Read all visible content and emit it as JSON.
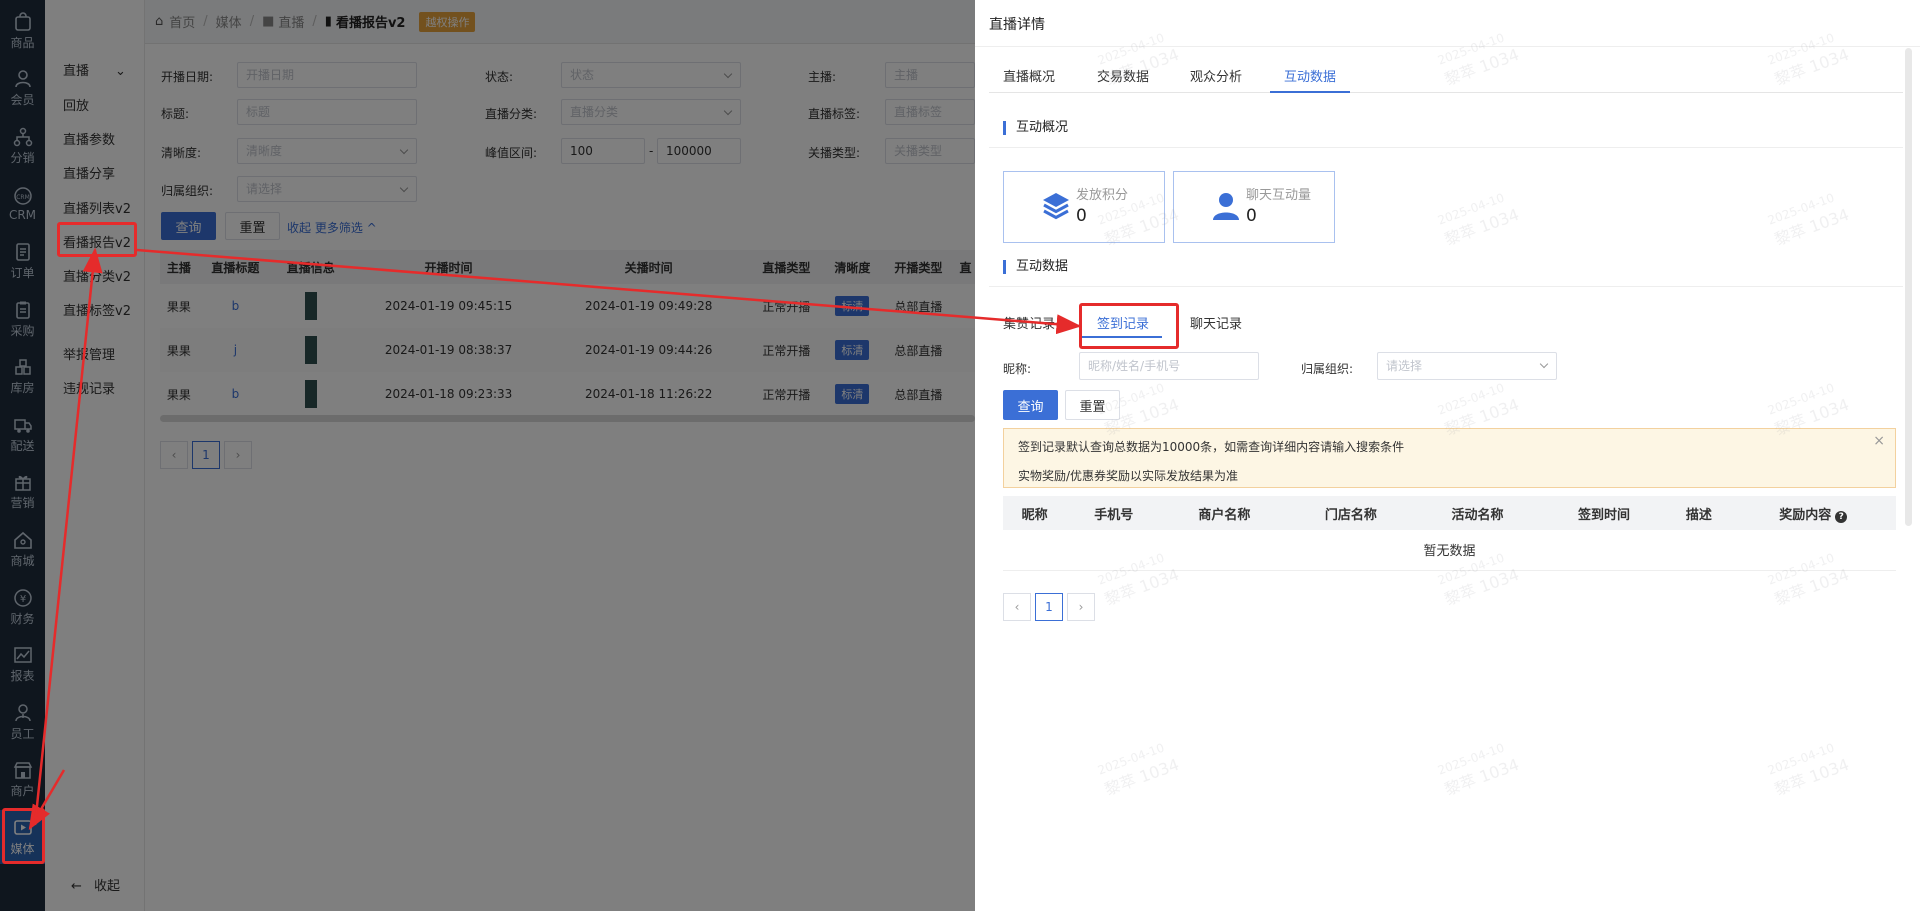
{
  "rail": {
    "items": [
      {
        "label": "商品",
        "icon": "bag-icon"
      },
      {
        "label": "会员",
        "icon": "user-icon"
      },
      {
        "label": "分销",
        "icon": "network-icon"
      },
      {
        "label": "CRM",
        "icon": "crm-icon"
      },
      {
        "label": "订单",
        "icon": "order-icon"
      },
      {
        "label": "采购",
        "icon": "clipboard-icon"
      },
      {
        "label": "库房",
        "icon": "warehouse-icon"
      },
      {
        "label": "配送",
        "icon": "truck-icon"
      },
      {
        "label": "营销",
        "icon": "gift-icon"
      },
      {
        "label": "商城",
        "icon": "home-icon"
      },
      {
        "label": "财务",
        "icon": "yen-icon"
      },
      {
        "label": "报表",
        "icon": "chart-icon"
      },
      {
        "label": "员工",
        "icon": "staff-icon"
      },
      {
        "label": "商户",
        "icon": "shop-icon"
      },
      {
        "label": "媒体",
        "icon": "media-icon"
      }
    ],
    "active_label": "媒体"
  },
  "submenu": {
    "group": "直播",
    "items": [
      "回放",
      "直播参数",
      "直播分享",
      "直播列表v2",
      "看播报告v2",
      "直播分类v2",
      "直播标签v2"
    ],
    "extra": [
      "举报管理",
      "违规记录"
    ],
    "collapse": "收起"
  },
  "breadcrumb": {
    "home": "首页",
    "media": "媒体",
    "live": "直播",
    "current": "看播报告v2",
    "tag": "越权操作"
  },
  "filters": {
    "start_date": {
      "label": "开播日期:",
      "placeholder": "开播日期"
    },
    "status": {
      "label": "状态:",
      "placeholder": "状态"
    },
    "anchor": {
      "label": "主播:",
      "placeholder": "主播"
    },
    "title": {
      "label": "标题:",
      "placeholder": "标题"
    },
    "category": {
      "label": "直播分类:",
      "placeholder": "直播分类"
    },
    "live_tag": {
      "label": "直播标签:",
      "placeholder": "直播标签"
    },
    "clarity": {
      "label": "清晰度:",
      "placeholder": "清晰度"
    },
    "peak": {
      "label": "峰值区间:",
      "from": "100",
      "dash": "-",
      "to": "100000"
    },
    "close_type": {
      "label": "关播类型:",
      "placeholder": "关播类型"
    },
    "org": {
      "label": "归属组织:",
      "placeholder": "请选择"
    },
    "query": "查询",
    "reset": "重置",
    "toggle": "收起 更多筛选"
  },
  "live_table": {
    "headers": [
      "主播",
      "直播标题",
      "直播信息",
      "开播时间",
      "关播时间",
      "直播类型",
      "清晰度",
      "开播类型",
      "直"
    ],
    "rows": [
      {
        "anchor": "果果",
        "title": "b",
        "start": "2024-01-19 09:45:15",
        "end": "2024-01-19 09:49:28",
        "type": "正常开播",
        "clarity": "标清",
        "open_type": "总部直播"
      },
      {
        "anchor": "果果",
        "title": "j",
        "start": "2024-01-19 08:38:37",
        "end": "2024-01-19 09:44:26",
        "type": "正常开播",
        "clarity": "标清",
        "open_type": "总部直播"
      },
      {
        "anchor": "果果",
        "title": "b",
        "start": "2024-01-18 09:23:33",
        "end": "2024-01-18 11:26:22",
        "type": "正常开播",
        "clarity": "标清",
        "open_type": "总部直播"
      }
    ],
    "page": "1"
  },
  "drawer": {
    "title": "直播详情",
    "tabs": [
      "直播概况",
      "交易数据",
      "观众分析",
      "互动数据"
    ],
    "active_tab": "互动数据",
    "overview_title": "互动概况",
    "cards": [
      {
        "label": "发放积分",
        "value": "0"
      },
      {
        "label": "聊天互动量",
        "value": "0"
      }
    ],
    "data_title": "互动数据",
    "subtabs": [
      "集赞记录",
      "签到记录",
      "聊天记录"
    ],
    "active_subtab": "签到记录",
    "nickname": {
      "label": "昵称:",
      "placeholder": "昵称/姓名/手机号"
    },
    "org": {
      "label": "归属组织:",
      "placeholder": "请选择"
    },
    "query": "查询",
    "reset": "重置",
    "notice": [
      "签到记录默认查询总数据为10000条，如需查询详细内容请输入搜索条件",
      "实物奖励/优惠券奖励以实际发放结果为准"
    ],
    "table_headers": [
      "昵称",
      "手机号",
      "商户名称",
      "门店名称",
      "活动名称",
      "签到时间",
      "描述",
      "奖励内容"
    ],
    "empty": "暂无数据",
    "page": "1"
  },
  "watermark": {
    "date": "2025-04-10",
    "name": "黎萃 1034"
  },
  "colors": {
    "accent": "#3b6fd6",
    "rail": "#1f2d3d",
    "annotation": "#e52b2b",
    "warning": "#e6a23c"
  }
}
